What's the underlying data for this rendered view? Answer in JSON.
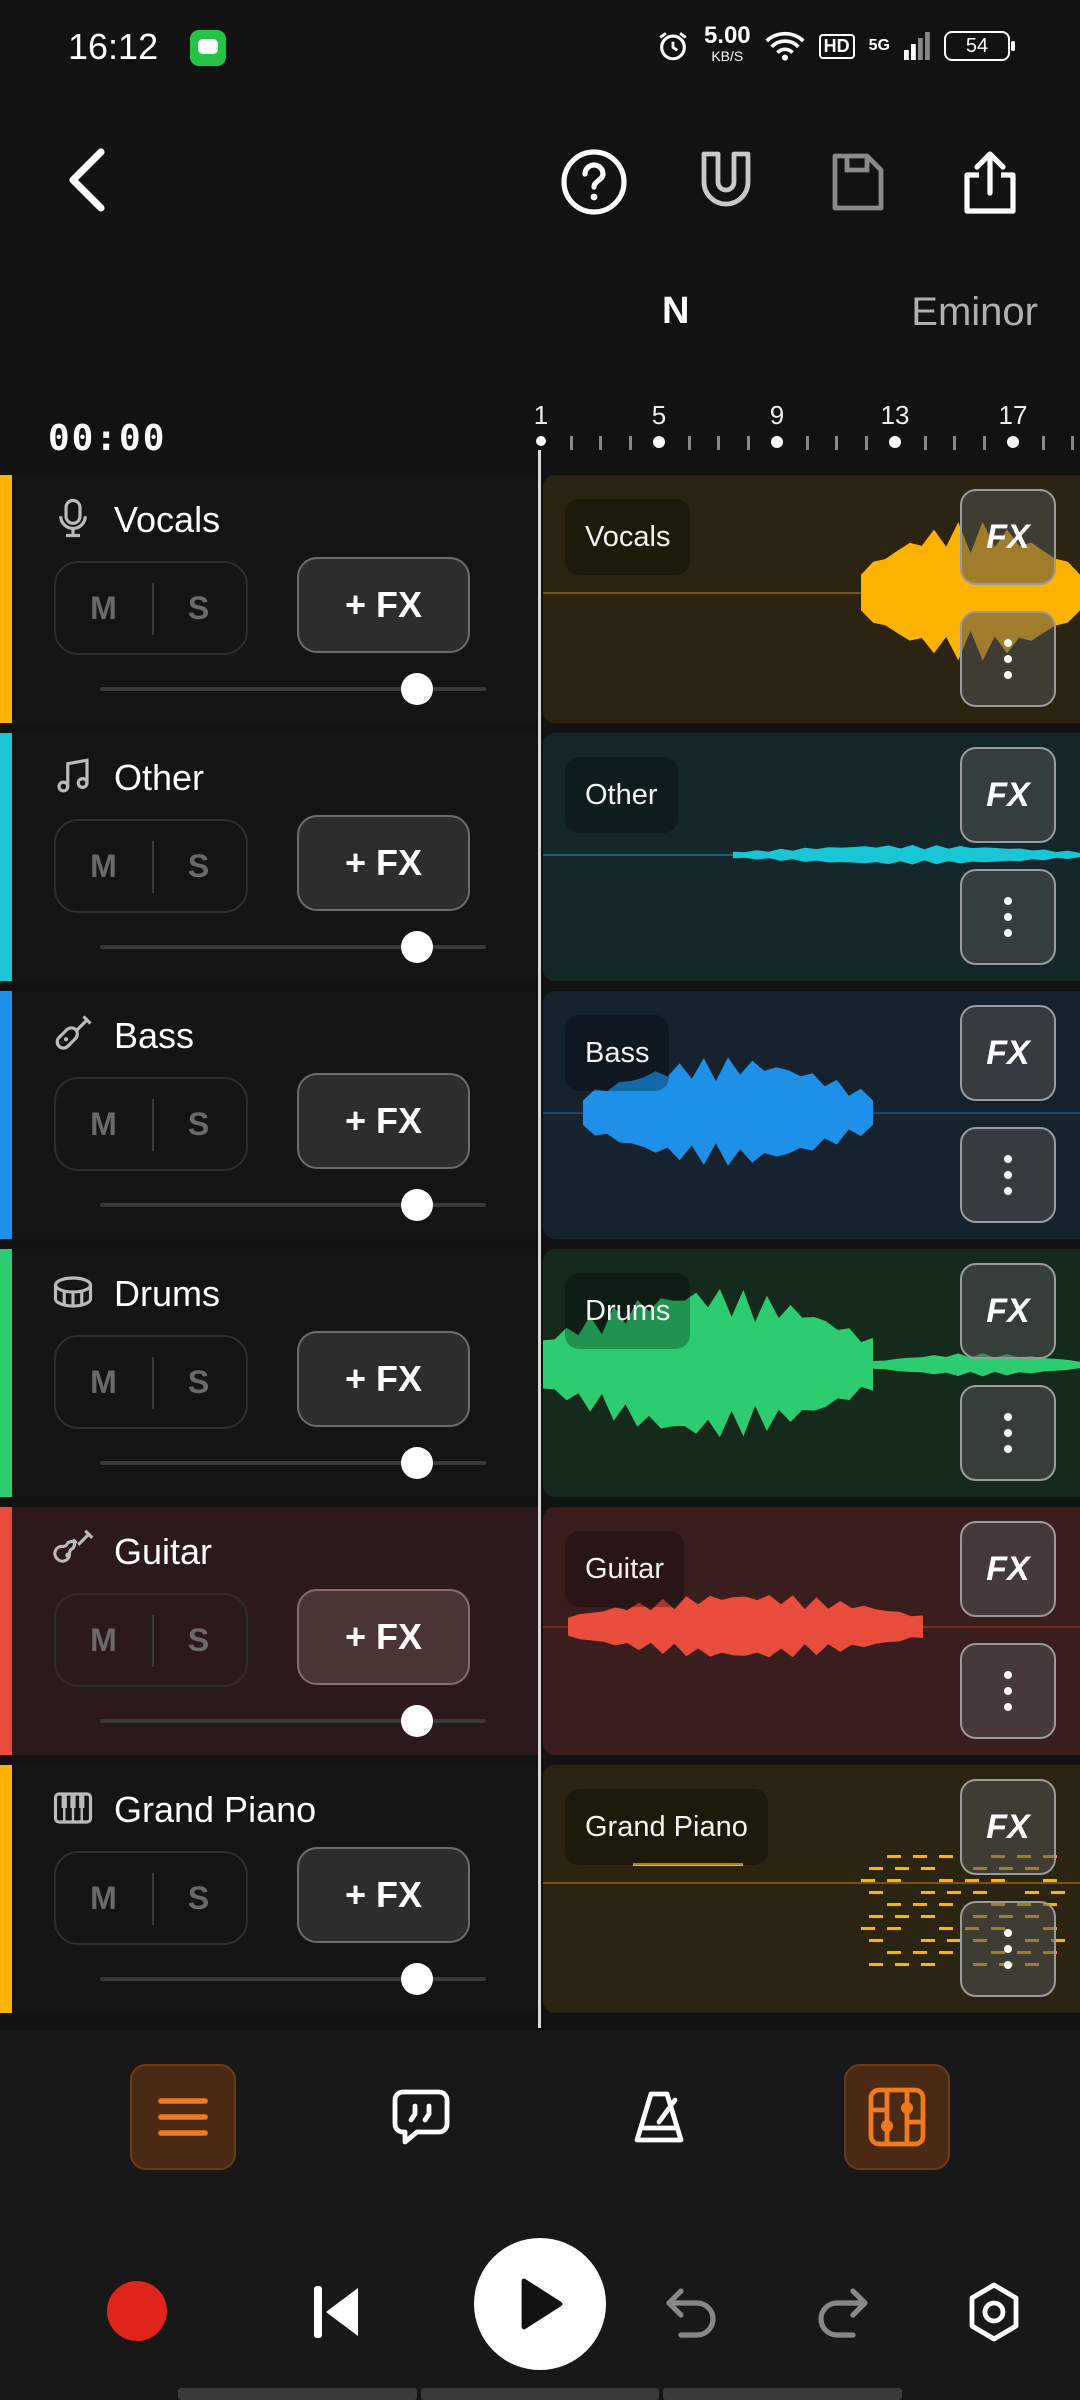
{
  "status_bar": {
    "time": "16:12",
    "net_speed": "5.00",
    "net_unit": "KB/S",
    "hd": "HD",
    "signal": "5G",
    "battery": "54"
  },
  "toolbar": {
    "back_icon": "chevron-left-icon",
    "help_icon": "help-circle-icon",
    "snap_icon": "magnet-icon",
    "save_icon": "save-icon",
    "share_icon": "share-icon"
  },
  "key": {
    "note": "N",
    "scale": "Eminor"
  },
  "timecode": "00:00",
  "ruler": {
    "labels": [
      "1",
      "5",
      "9",
      "13",
      "17"
    ]
  },
  "tracks": [
    {
      "name": "Vocals",
      "icon": "microphone-icon",
      "color": "#FFB300",
      "bg": "#2a2410",
      "clip_label": "Vocals",
      "mute": "M",
      "solo": "S",
      "fx_add": "+ FX",
      "fx": "FX",
      "volume": 0.82
    },
    {
      "name": "Other",
      "icon": "music-note-icon",
      "color": "#19C6D6",
      "bg": "#14282c",
      "clip_label": "Other",
      "mute": "M",
      "solo": "S",
      "fx_add": "+ FX",
      "fx": "FX",
      "volume": 0.82
    },
    {
      "name": "Bass",
      "icon": "bass-guitar-icon",
      "color": "#1E90E8",
      "bg": "#16222e",
      "clip_label": "Bass",
      "mute": "M",
      "solo": "S",
      "fx_add": "+ FX",
      "fx": "FX",
      "volume": 0.82
    },
    {
      "name": "Drums",
      "icon": "drum-icon",
      "color": "#2ECC71",
      "bg": "#162a1c",
      "clip_label": "Drums",
      "mute": "M",
      "solo": "S",
      "fx_add": "+ FX",
      "fx": "FX",
      "volume": 0.82
    },
    {
      "name": "Guitar",
      "icon": "guitar-icon",
      "color": "#E74C3C",
      "bg": "#3a1e1e",
      "clip_label": "Guitar",
      "mute": "M",
      "solo": "S",
      "fx_add": "+ FX",
      "fx": "FX",
      "volume": 0.82
    },
    {
      "name": "Grand Piano",
      "icon": "piano-icon",
      "color": "#FFB300",
      "bg": "#2a2410",
      "clip_label": "Grand Piano",
      "mute": "M",
      "solo": "S",
      "fx_add": "+ FX",
      "fx": "FX",
      "volume": 0.82
    }
  ],
  "bottom_nav": {
    "items": [
      "menu-icon",
      "chat-quote-icon",
      "metronome-icon",
      "mixer-icon"
    ],
    "accent": "#F07A1E"
  },
  "transport": {
    "record_color": "#E0241B",
    "items": [
      "record-icon",
      "skip-to-start-icon",
      "play-icon",
      "undo-icon",
      "redo-icon",
      "settings-icon"
    ]
  }
}
